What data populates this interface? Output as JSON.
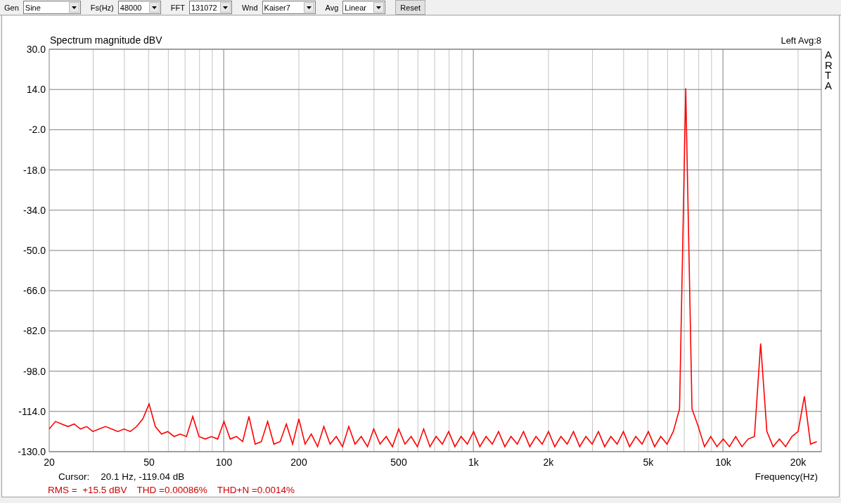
{
  "toolbar": {
    "controls": [
      {
        "label": "Gen",
        "value": "Sine"
      },
      {
        "label": "Fs(Hz)",
        "value": "48000"
      },
      {
        "label": "FFT",
        "value": "131072"
      },
      {
        "label": "Wnd",
        "value": "Kaiser7"
      },
      {
        "label": "Avg",
        "value": "Linear"
      }
    ],
    "reset_button": "Reset"
  },
  "chart": {
    "average": "Avg:8",
    "brand": "ARTA",
    "chart_data": {
      "type": "line",
      "title": "Spectrum magnitude dBV",
      "xlabel": "Frequency(Hz)",
      "categories": [
        "20",
        null,
        null,
        null,
        null,
        null,
        null,
        null,
        null,
        null,
        null,
        null,
        null,
        null,
        null,
        null,
        "50",
        null,
        null,
        null,
        null,
        null,
        null,
        null,
        null,
        null,
        null,
        null,
        "100",
        null,
        null,
        null,
        null,
        null,
        null,
        null,
        null,
        null,
        null,
        null,
        "200",
        null,
        null,
        null,
        null,
        null,
        null,
        null,
        null,
        null,
        null,
        null,
        null,
        null,
        null,
        null,
        "500",
        null,
        null,
        null,
        null,
        null,
        null,
        null,
        null,
        null,
        null,
        null,
        "1k",
        null,
        null,
        null,
        null,
        null,
        null,
        null,
        null,
        null,
        null,
        null,
        "2k",
        null,
        null,
        null,
        null,
        null,
        null,
        null,
        null,
        null,
        null,
        null,
        null,
        null,
        null,
        null,
        "5k",
        null,
        null,
        null,
        null,
        null,
        null,
        null,
        null,
        null,
        null,
        null,
        "10k",
        null,
        null,
        null,
        null,
        null,
        null,
        null,
        null,
        null,
        null,
        null,
        "20k",
        null,
        null,
        null
      ],
      "series": [
        {
          "name": "Left",
          "color": "#ff0000",
          "values": [
            -121,
            -118,
            -119,
            -120,
            -119,
            -121,
            -120,
            -122,
            -121,
            -120,
            -121,
            -122,
            -121,
            -122,
            -120,
            -117,
            -111,
            -120,
            -123,
            -122,
            -124,
            -123,
            -124,
            -116,
            -124,
            -125,
            -124,
            -125,
            -118,
            -125,
            -124,
            -126,
            -116,
            -127,
            -126,
            -118,
            -127,
            -126,
            -119,
            -127,
            -117,
            -127,
            -123,
            -128,
            -120,
            -127,
            -124,
            -128,
            -120,
            -127,
            -124,
            -128,
            -121,
            -127,
            -124,
            -128,
            -121,
            -127,
            -124,
            -128,
            -121,
            -128,
            -124,
            -127,
            -122,
            -128,
            -124,
            -127,
            -122,
            -128,
            -124,
            -127,
            -122,
            -128,
            -124,
            -127,
            -122,
            -128,
            -124,
            -127,
            -122,
            -128,
            -124,
            -127,
            -122,
            -128,
            -124,
            -127,
            -122,
            -128,
            -124,
            -127,
            -122,
            -128,
            -124,
            -127,
            -122,
            -128,
            -124,
            -127,
            -122,
            -113,
            14.5,
            -113,
            -120,
            -128,
            -124,
            -128,
            -125,
            -128,
            -124,
            -128,
            -125,
            -124,
            -87,
            -122,
            -128,
            -125,
            -128,
            -124,
            -122,
            -108,
            -127,
            -126
          ]
        }
      ],
      "ylim": [
        -130,
        30
      ],
      "grid": true,
      "yticks": [
        {
          "value": 30,
          "label": "30.0"
        },
        {
          "value": 14,
          "label": "14.0"
        },
        {
          "value": -2,
          "label": "-2.0"
        },
        {
          "value": -18,
          "label": "-18.0"
        },
        {
          "value": -34,
          "label": "-34.0"
        },
        {
          "value": -50,
          "label": "-50.0"
        },
        {
          "value": -66,
          "label": "-66.0"
        },
        {
          "value": -82,
          "label": "-82.0"
        },
        {
          "value": -98,
          "label": "-98.0"
        },
        {
          "value": -114,
          "label": "-114.0"
        },
        {
          "value": -130,
          "label": "-130.0"
        }
      ]
    }
  },
  "footer": {
    "cursor_label": "Cursor:",
    "cursor_value": "20.1 Hz, -119.04 dB",
    "measurements": [
      "RMS =  +15.5 dBV",
      "THD =0.00086%",
      "THD+N =0.0014%"
    ]
  }
}
